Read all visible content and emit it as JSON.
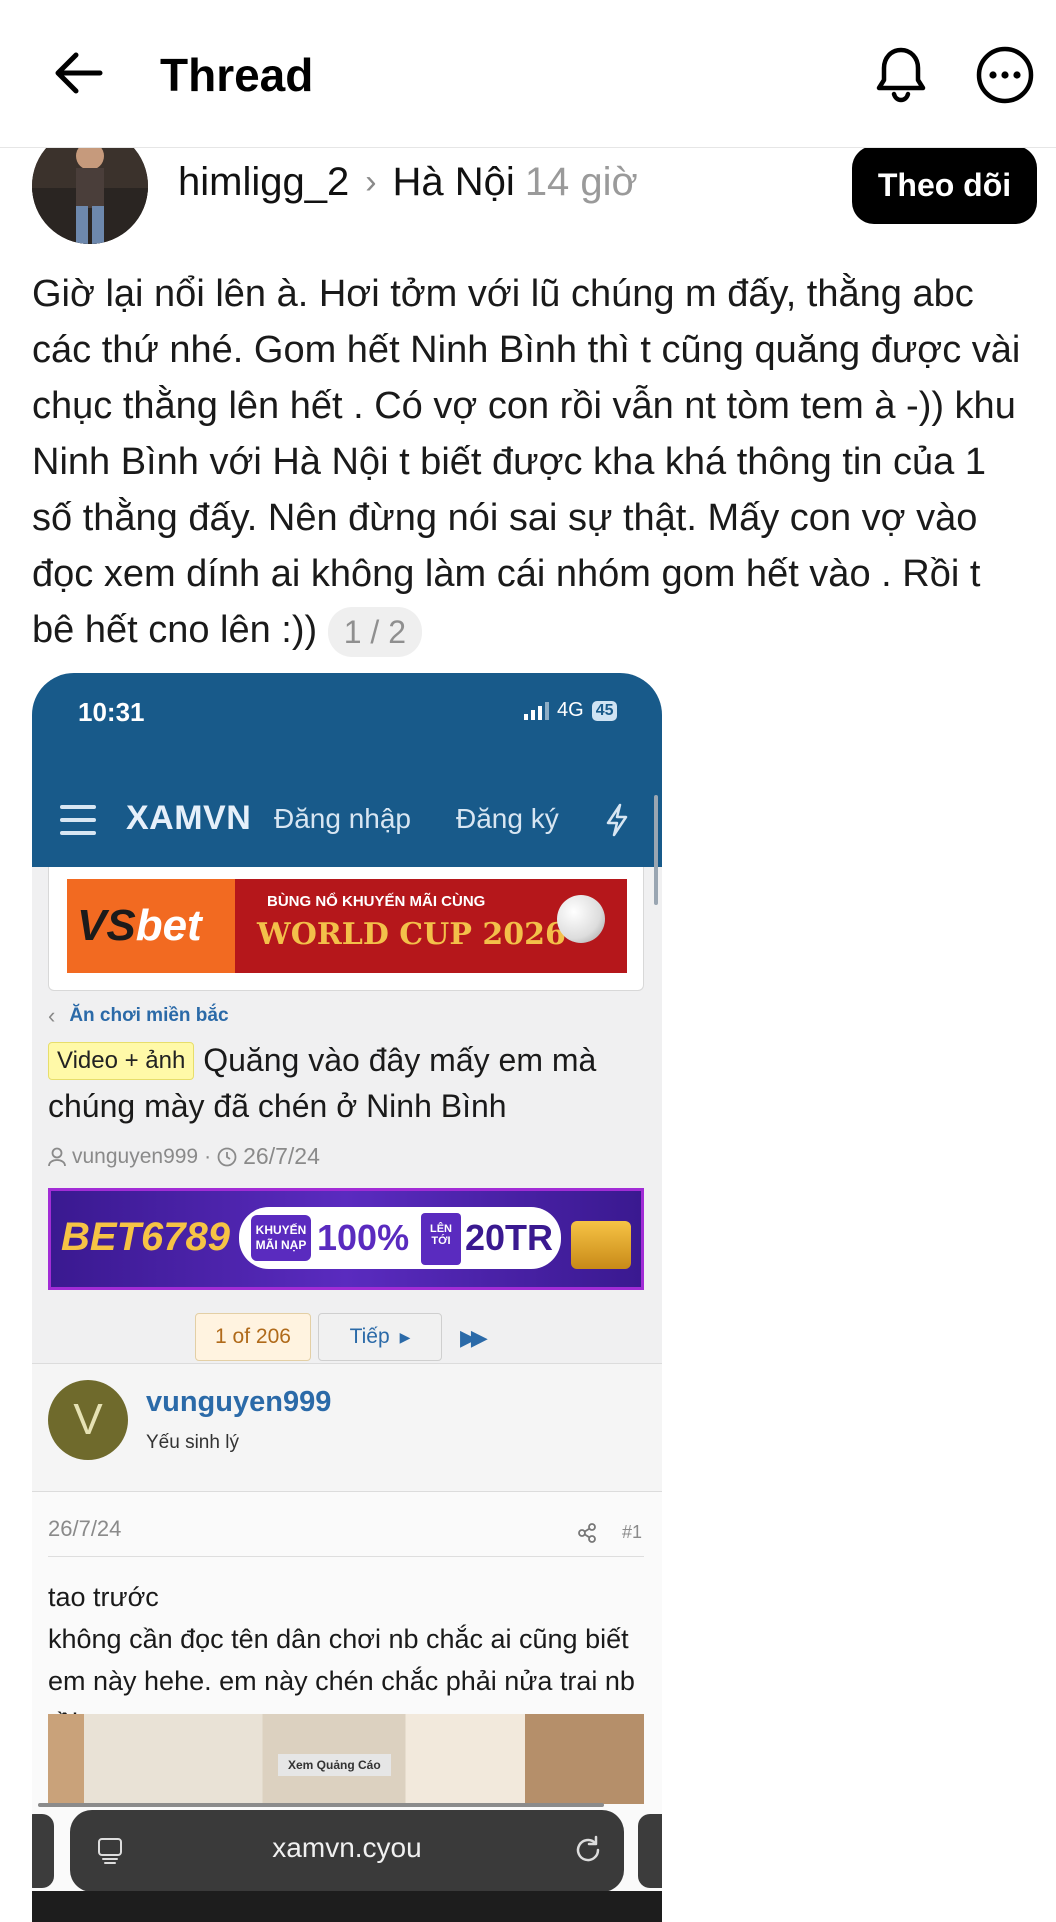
{
  "header": {
    "title": "Thread",
    "back_icon": "arrow-left-icon",
    "notification_icon": "bell-icon",
    "more_icon": "more-horizontal-icon"
  },
  "post": {
    "author": "himligg_2",
    "community": "Hà Nội",
    "time": "14 giờ",
    "follow_label": "Theo dõi",
    "text": "Giờ lại nổi lên à. Hơi tởm với lũ chúng m đấy,  thằng abc các thứ nhé. Gom hết Ninh Bình thì t cũng quăng được vài chục thằng lên hết . Có vợ con rồi vẫn nt tòm tem à -)) khu Ninh Bình với Hà Nội t biết được kha khá thông tin của 1 số thằng đấy. Nên đừng nói sai  sự thật. Mấy con vợ vào đọc xem dính ai không làm cái nhóm gom hết vào . Rồi t bê hết cno lên :))",
    "image_counter": "1 / 2"
  },
  "screenshot": {
    "status_time": "10:31",
    "network": "4G",
    "battery": "45",
    "site_logo": "XAMVN",
    "login": "Đăng nhập",
    "register": "Đăng ký",
    "ad1": {
      "brand_a": "VS",
      "brand_b": "bet",
      "tagline": "BÙNG NỔ KHUYẾN MÃI CÙNG",
      "headline": "WORLD CUP 2026"
    },
    "breadcrumb": "Ăn chơi miền bắc",
    "tag": "Video + ảnh",
    "title": "Quăng vào đây mấy em mà chúng mày đã chén ở Ninh Bình",
    "thread_author": "vunguyen999",
    "thread_date": "26/7/24",
    "ad2": {
      "brand": "BET6789",
      "promo": "KHUYẾN MÃI NẠP",
      "percent": "100%",
      "upto": "LÊN TỚI",
      "amount": "20TR"
    },
    "pager": {
      "current": "1 of 206",
      "next": "Tiếp"
    },
    "poster": {
      "initial": "V",
      "name": "vunguyen999",
      "rank": "Yếu sinh lý"
    },
    "post_date": "26/7/24",
    "post_number": "#1",
    "post_text_line1": "tao trước",
    "post_text_rest": "không cần đọc tên dân chơi nb chắc ai cũng biết em này hehe. em này chén chắc phải nửa trai nb rồi",
    "image_label": "Xem Quảng Cáo",
    "url": "xamvn.cyou"
  }
}
